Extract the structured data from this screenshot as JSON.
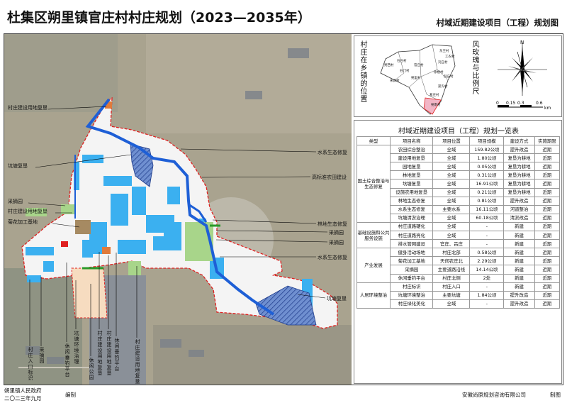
{
  "header": {
    "title": "杜集区朔里镇官庄村村庄规划（2023—2035年）",
    "subtitle": "村域近期建设项目（工程）规划图"
  },
  "map_labels": {
    "left": [
      "村庄建设用地复垦",
      "坑塘复垦",
      "采摘园",
      "村庄建设用地复垦",
      "菊花加工基地"
    ],
    "right": [
      "水系生态修复",
      "高标准农田建设",
      "林地生态修复",
      "采摘园",
      "采摘园",
      "水系生态修复",
      "坑塘复垦"
    ],
    "bottom": [
      "村庄入口标识",
      "采摘园",
      "休闲垂钓平台",
      "坑塘环境治理",
      "休闲公园",
      "村庄建设用地复垦",
      "村庄建设用地复垦",
      "休闲垂钓平台",
      "村庄建设用地复垦"
    ]
  },
  "location": {
    "title": "村庄在乡镇的位置",
    "towns": [
      "朔西村",
      "石台村",
      "石门村",
      "官庄村",
      "东王村",
      "宋郢村",
      "朔里村",
      "刘庄村",
      "徐楼村",
      "倪庄村",
      "工农村",
      "渠沟村",
      "朔南村",
      "葛庄村"
    ]
  },
  "compass": {
    "title": "风玫瑰与比例尺",
    "north": "N",
    "scale": [
      "0",
      "0.15",
      "0.3",
      "0.6"
    ],
    "unit": "km"
  },
  "table": {
    "title": "村域近期建设项目（工程）规划一览表",
    "headers": [
      "类型",
      "项目名称",
      "项目位置",
      "项目规模",
      "建设方式",
      "实施期限"
    ],
    "groups": [
      {
        "type": "国土综合整治与生态修复",
        "rows": [
          [
            "农田综合整治",
            "全域",
            "159.82公顷",
            "提升改造",
            "近期"
          ],
          [
            "建设用地复垦",
            "全域",
            "1.80公顷",
            "复垦为耕地",
            "近期"
          ],
          [
            "园地复垦",
            "全域",
            "0.05公顷",
            "复垦为耕地",
            "近期"
          ],
          [
            "林地复垦",
            "全域",
            "0.31公顷",
            "复垦为耕地",
            "近期"
          ],
          [
            "坑塘复垦",
            "全域",
            "16.91公顷",
            "复垦为耕地",
            "近期"
          ],
          [
            "设施农用地复垦",
            "全域",
            "0.21公顷",
            "复垦为耕地",
            "近期"
          ],
          [
            "林地生态修复",
            "全域",
            "0.81公顷",
            "提升改造",
            "近期"
          ],
          [
            "水系生态修复",
            "主要水系",
            "16.11公顷",
            "河道整治",
            "近期"
          ],
          [
            "坑塘清淤治理",
            "全域",
            "60.18公顷",
            "清淤改造",
            "近期"
          ]
        ]
      },
      {
        "type": "基础设施和公共服务设施",
        "rows": [
          [
            "村庄道路硬化",
            "全域",
            "-",
            "新建",
            "近期"
          ],
          [
            "村庄道路亮化",
            "全域",
            "-",
            "新建",
            "近期"
          ],
          [
            "排水管网建设",
            "官庄、吕庄",
            "-",
            "新建",
            "近期"
          ]
        ]
      },
      {
        "type": "产业发展",
        "rows": [
          [
            "健身活动场地",
            "村庄北部",
            "0.58公顷",
            "新建",
            "近期"
          ],
          [
            "菊花加工基地",
            "天伺农庄北",
            "2.29公顷",
            "新建",
            "近期"
          ],
          [
            "采摘园",
            "主要道路沿线",
            "14.14公顷",
            "新建",
            "近期"
          ],
          [
            "休闲垂钓平台",
            "村庄北侧",
            "2处",
            "新建",
            "近期"
          ]
        ]
      },
      {
        "type": "人居环境整治",
        "rows": [
          [
            "村庄标识",
            "村庄入口",
            "-",
            "新建",
            "近期"
          ],
          [
            "坑塘环境整治",
            "主要坑塘",
            "1.84公顷",
            "提升改造",
            "近期"
          ],
          [
            "村庄绿化美化",
            "全域",
            "-",
            "提升改造",
            "近期"
          ]
        ]
      }
    ]
  },
  "footer": {
    "left1": "朔里镇人民政府",
    "left2": "二〇二三年九月",
    "mid": "编制",
    "right1": "安徽尚原规划咨询有限公司",
    "right2": "制图"
  },
  "colors": {
    "water": "#1e5fd6",
    "farmland": "#f4f4f4",
    "redline": "#e02020",
    "orchard": "#a8d58a"
  }
}
